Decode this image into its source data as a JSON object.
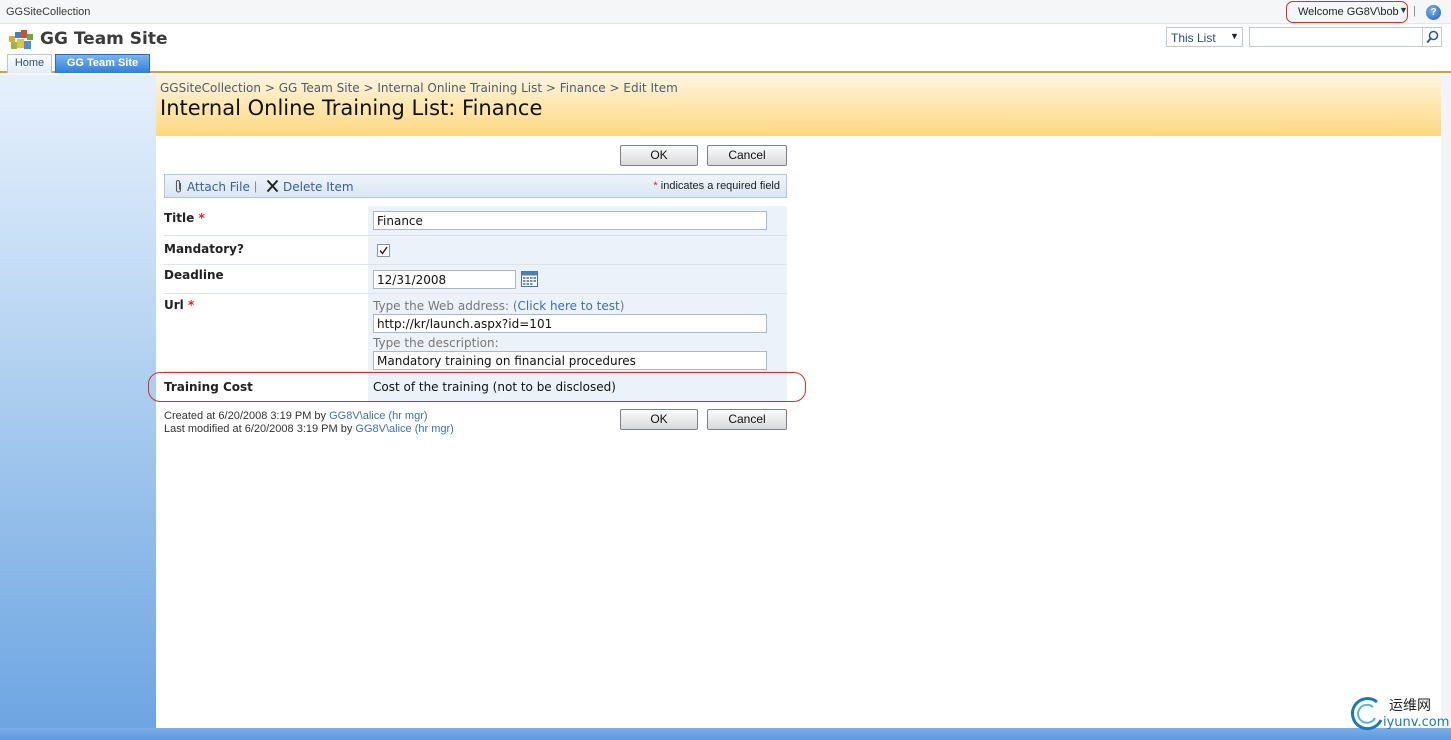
{
  "topbar": {
    "site_collection": "GGSiteCollection",
    "welcome": "Welcome GG8V\\bob",
    "separator": "|"
  },
  "header": {
    "site_title": "GG Team Site",
    "search_scope": "This List",
    "search_value": ""
  },
  "tabs": [
    {
      "label": "Home",
      "selected": false
    },
    {
      "label": "GG Team Site",
      "selected": true
    }
  ],
  "page": {
    "breadcrumb": [
      "GGSiteCollection",
      "GG Team Site",
      "Internal Online Training List",
      "Finance",
      "Edit Item"
    ],
    "breadcrumb_separator": " > ",
    "title": "Internal Online Training List: Finance"
  },
  "buttons": {
    "ok": "OK",
    "cancel": "Cancel"
  },
  "toolbar": {
    "attach_file": "Attach File",
    "separator": "|",
    "delete_item": "Delete Item",
    "required_star": "*",
    "required_note": " indicates a required field"
  },
  "form": {
    "required_star": "*",
    "title": {
      "label": "Title",
      "value": "Finance"
    },
    "mandatory": {
      "label": "Mandatory?",
      "checked": true
    },
    "deadline": {
      "label": "Deadline",
      "value": "12/31/2008"
    },
    "url": {
      "label": "Url",
      "web_address_hint": "Type the Web address: (",
      "test_link": "Click here to test",
      "hint_close": ")",
      "web_address": "http://kr/launch.aspx?id=101",
      "description_hint": "Type the description:",
      "description": "Mandatory training on financial procedures"
    },
    "training_cost": {
      "label": "Training Cost",
      "value": "Cost of the training (not to be disclosed)"
    }
  },
  "meta": {
    "created_prefix": "Created at 6/20/2008 3:19 PM  by ",
    "created_by": "GG8V\\alice (hr mgr)",
    "modified_prefix": "Last modified at 6/20/2008 3:19 PM  by ",
    "modified_by": "GG8V\\alice (hr mgr)"
  },
  "watermark": {
    "line1": "运维网",
    "line2": "iyunv.com"
  },
  "colors": {
    "highlight": "#d0302a",
    "title_band": "#fdd87f",
    "link": "#3b6fb5"
  }
}
